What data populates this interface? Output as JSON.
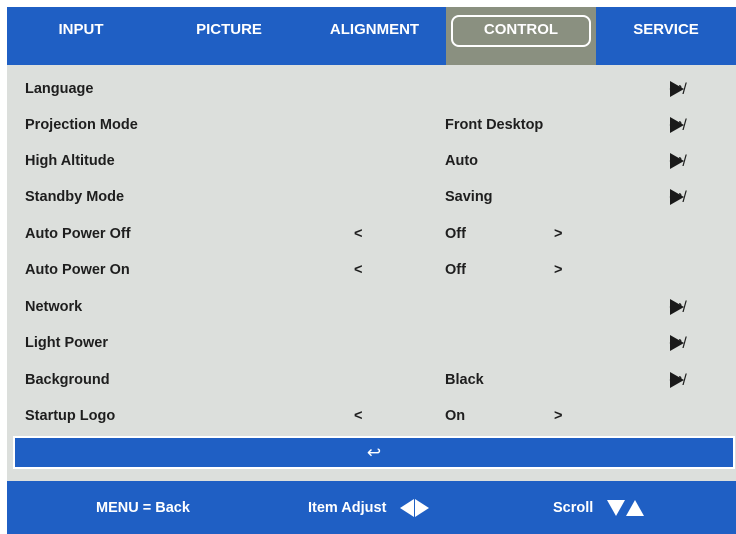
{
  "colors": {
    "accent": "#1f5fc4",
    "panel": "#dcdfdc",
    "active_tab": "#8a9080"
  },
  "tabs": [
    {
      "label": "INPUT",
      "active": false
    },
    {
      "label": "PICTURE",
      "active": false
    },
    {
      "label": "ALIGNMENT",
      "active": false
    },
    {
      "label": "CONTROL",
      "active": true
    },
    {
      "label": "SERVICE",
      "active": false
    }
  ],
  "menu": {
    "enter_symbol": "↩/",
    "items": [
      {
        "label": "Language",
        "value": "",
        "type": "submenu"
      },
      {
        "label": "Projection Mode",
        "value": "Front Desktop",
        "type": "submenu"
      },
      {
        "label": "High Altitude",
        "value": "Auto",
        "type": "submenu"
      },
      {
        "label": "Standby Mode",
        "value": "Saving",
        "type": "submenu"
      },
      {
        "label": "Auto Power Off",
        "value": "Off",
        "type": "adjust",
        "left": "<",
        "right": ">"
      },
      {
        "label": "Auto Power On",
        "value": "Off",
        "type": "adjust",
        "left": "<",
        "right": ">"
      },
      {
        "label": "Network",
        "value": "",
        "type": "submenu"
      },
      {
        "label": "Light Power",
        "value": "",
        "type": "submenu"
      },
      {
        "label": "Background",
        "value": "Black",
        "type": "submenu"
      },
      {
        "label": "Startup Logo",
        "value": "On",
        "type": "adjust",
        "left": "<",
        "right": ">"
      }
    ]
  },
  "return_bar": {
    "symbol": "↩"
  },
  "footer": {
    "menu_back": "MENU = Back",
    "item_adjust": "Item Adjust",
    "scroll": "Scroll",
    "icons": [
      "triangle-left-icon",
      "triangle-right-icon",
      "triangle-down-icon",
      "triangle-up-icon"
    ]
  }
}
